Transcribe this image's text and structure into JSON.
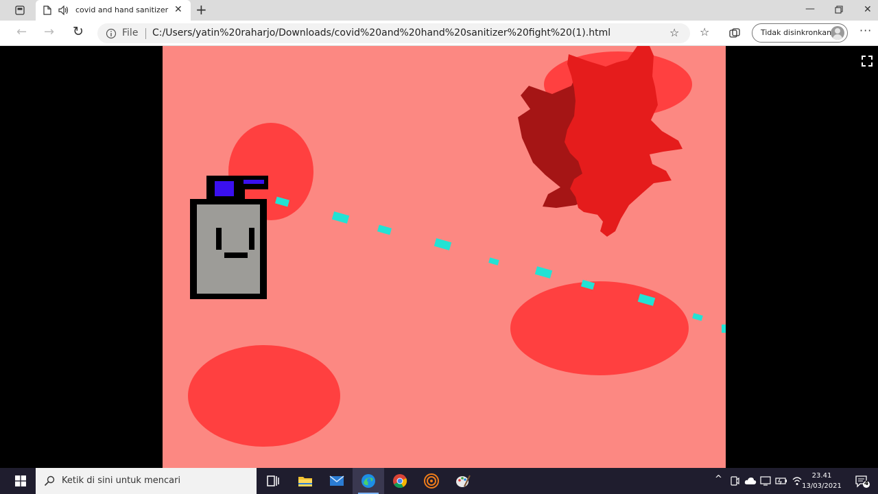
{
  "browser": {
    "tab_title": "covid and hand sanitizer fight",
    "url_scheme_label": "File",
    "url": "C:/Users/yatin%20raharjo/Downloads/covid%20and%20hand%20sanitizer%20fight%20(1).html",
    "sync_label": "Tidak disinkronkan",
    "window_controls": [
      "minimize-icon",
      "restore-icon",
      "close-icon"
    ]
  },
  "game": {
    "background_color": "#fc8882",
    "blob_color": "#ff4040",
    "bullet_color": "#22e2d4",
    "virus_colors": [
      "#e51c1c",
      "#a51515"
    ],
    "sanitizer_body_color": "#9d9c98"
  },
  "taskbar": {
    "search_placeholder": "Ketik di sini untuk mencari",
    "time": "23.41",
    "date": "13/03/2021",
    "notification_count": "4",
    "apps": [
      "task-view-icon",
      "file-explorer-icon",
      "mail-icon",
      "edge-icon",
      "chrome-icon",
      "app-icon",
      "paint-icon"
    ]
  }
}
